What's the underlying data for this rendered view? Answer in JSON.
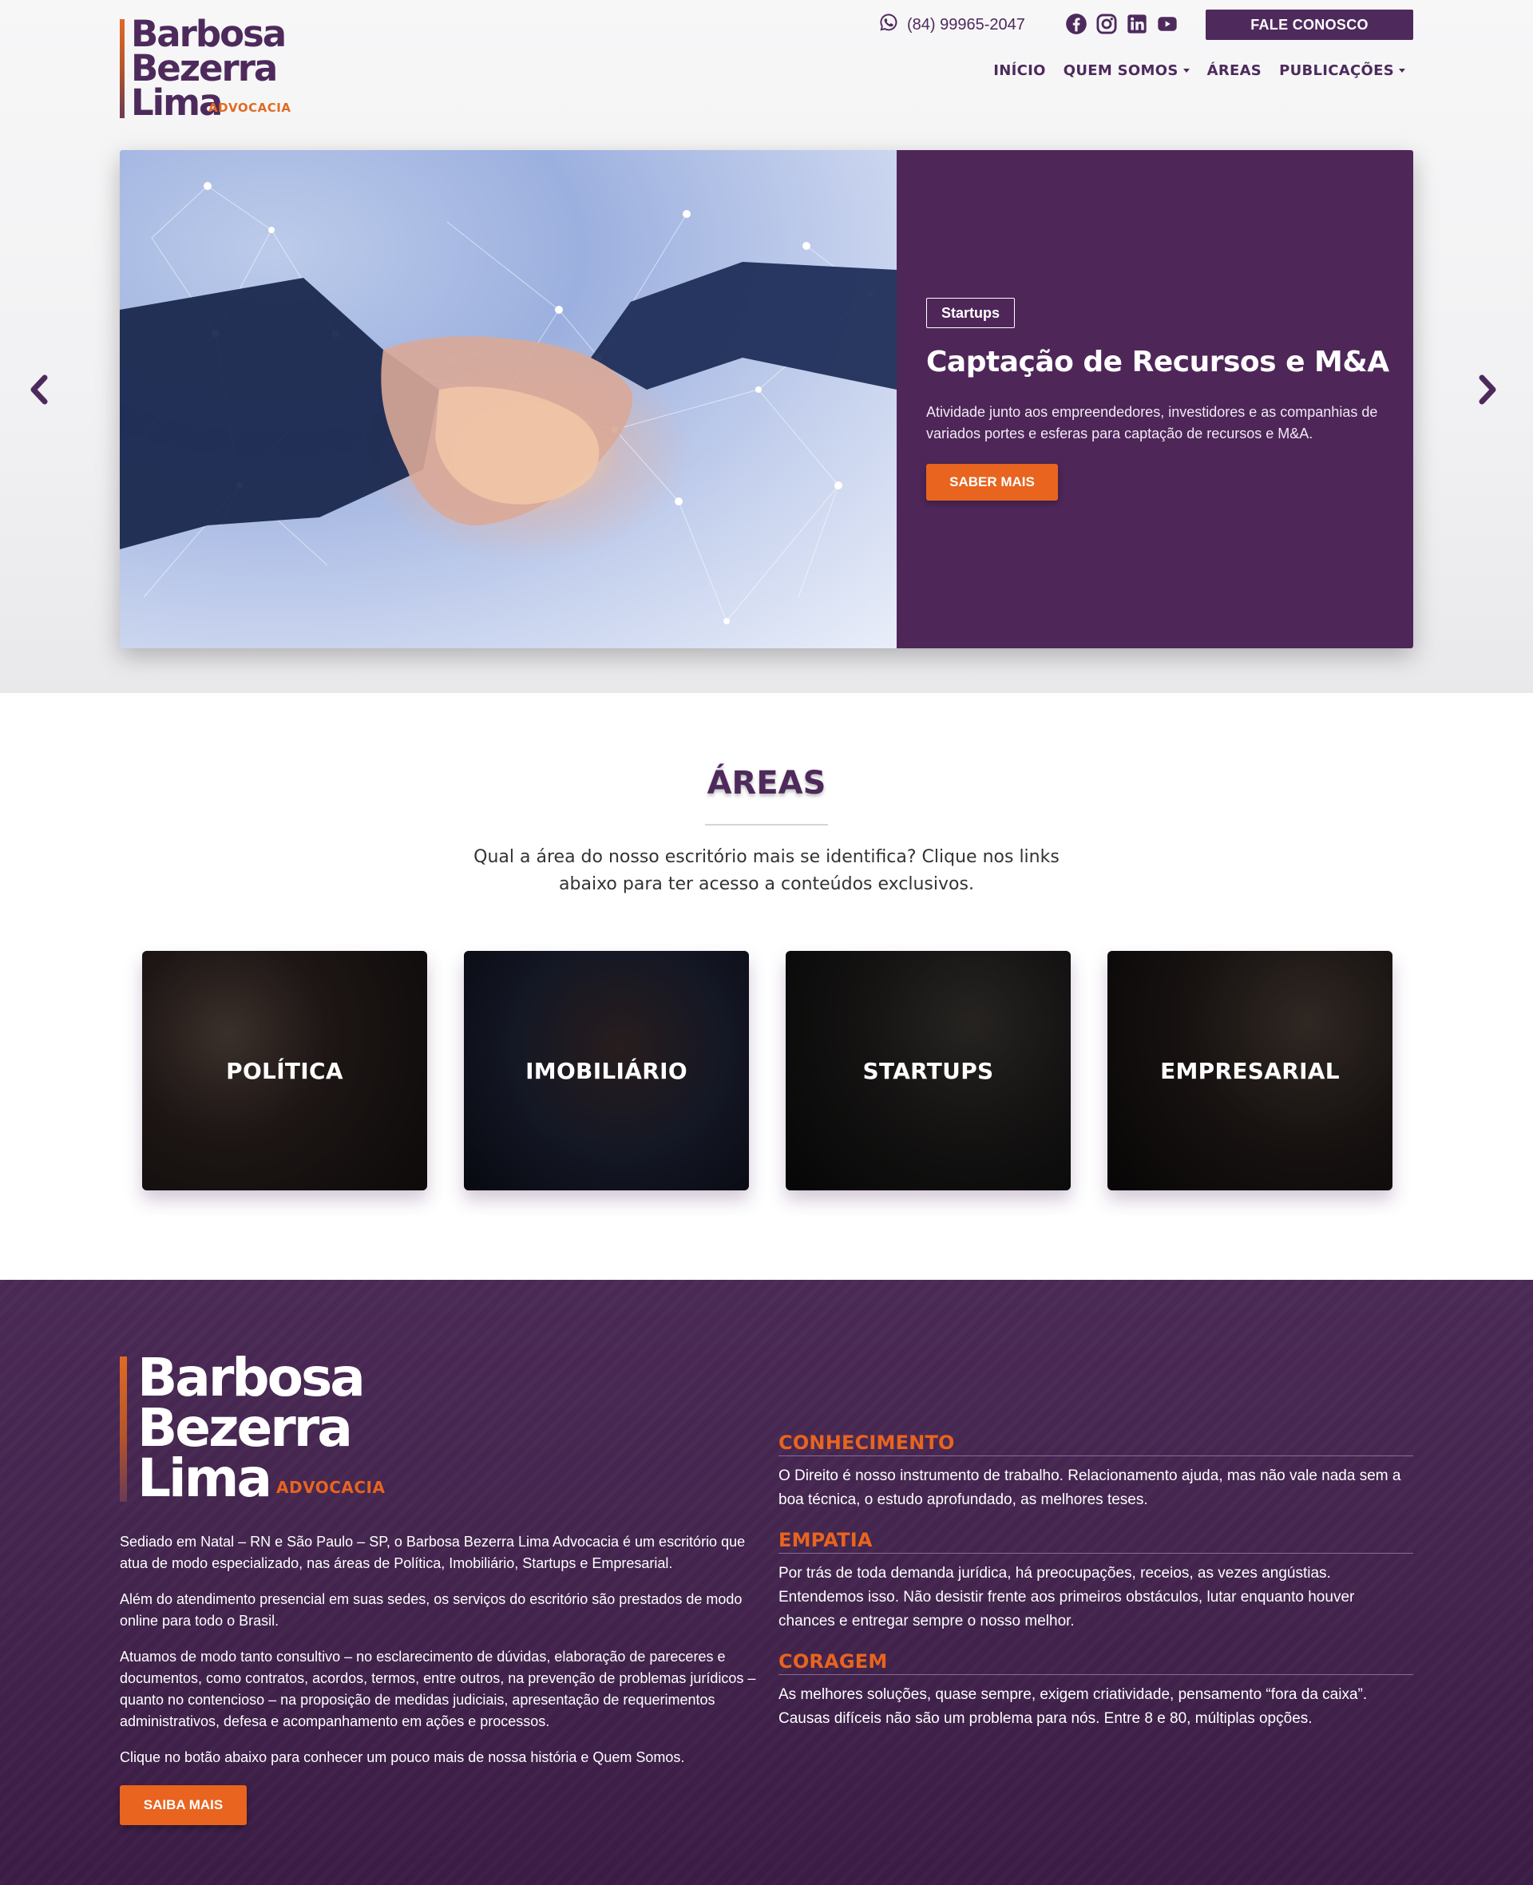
{
  "brand": {
    "line1": "Barbosa",
    "line2": "Bezerra",
    "line3": "Lima",
    "suffix": "ADVOCACIA",
    "purple": "#4e2a5c",
    "orange": "#e8641f"
  },
  "header": {
    "phone": "(84) 99965-2047",
    "phone_icon": "whatsapp-icon",
    "socials": [
      "facebook-icon",
      "instagram-icon",
      "linkedin-icon",
      "youtube-icon"
    ],
    "cta_label": "FALE CONOSCO",
    "nav": [
      {
        "label": "INÍCIO",
        "dropdown": false
      },
      {
        "label": "QUEM SOMOS",
        "dropdown": true
      },
      {
        "label": "ÁREAS",
        "dropdown": false
      },
      {
        "label": "PUBLICAÇÕES",
        "dropdown": true
      }
    ]
  },
  "slider": {
    "tag": "Startups",
    "title": "Captação de Recursos e M&A",
    "text": "Atividade junto aos empreendedores, investidores e as companhias de variados portes e esferas para captação de recursos e M&A.",
    "button": "SABER MAIS",
    "prev_icon": "chevron-left-icon",
    "next_icon": "chevron-right-icon"
  },
  "areas": {
    "title": "ÁREAS",
    "subtitle": "Qual a área do nosso escritório mais se identifica? Clique nos links abaixo para ter acesso a conteúdos exclusivos.",
    "cards": [
      "POLÍTICA",
      "IMOBILIÁRIO",
      "STARTUPS",
      "EMPRESARIAL"
    ]
  },
  "footer": {
    "paragraphs": [
      "Sediado em Natal – RN e São Paulo – SP, o Barbosa Bezerra Lima Advocacia é um escritório que atua de modo especializado, nas áreas de Política, Imobiliário, Startups e Empresarial.",
      "Além do atendimento presencial em suas sedes, os serviços do escritório são prestados de modo online para todo o Brasil.",
      "Atuamos de modo tanto consultivo – no esclarecimento de dúvidas, elaboração de pareceres e documentos, como contratos, acordos, termos, entre outros, na prevenção de problemas jurídicos – quanto no contencioso – na proposição de medidas judiciais, apresentação de requerimentos administrativos, defesa e acompanhamento em ações e processos.",
      "Clique no botão abaixo para conhecer um pouco mais de nossa história e Quem Somos."
    ],
    "button": "SAIBA MAIS",
    "values": [
      {
        "title": "CONHECIMENTO",
        "text": "O Direito é nosso instrumento de trabalho. Relacionamento ajuda, mas não vale nada sem a boa técnica, o estudo aprofundado, as melhores teses."
      },
      {
        "title": "EMPATIA",
        "text": "Por trás de toda demanda jurídica, há preocupações, receios, as vezes angústias. Entendemos isso. Não desistir frente aos primeiros obstáculos, lutar enquanto houver chances e entregar sempre o nosso melhor."
      },
      {
        "title": "CORAGEM",
        "text": "As melhores soluções, quase sempre, exigem criatividade, pensamento “fora da caixa”. Causas difíceis não são um problema para nós. Entre 8 e 80, múltiplas opções."
      }
    ]
  }
}
